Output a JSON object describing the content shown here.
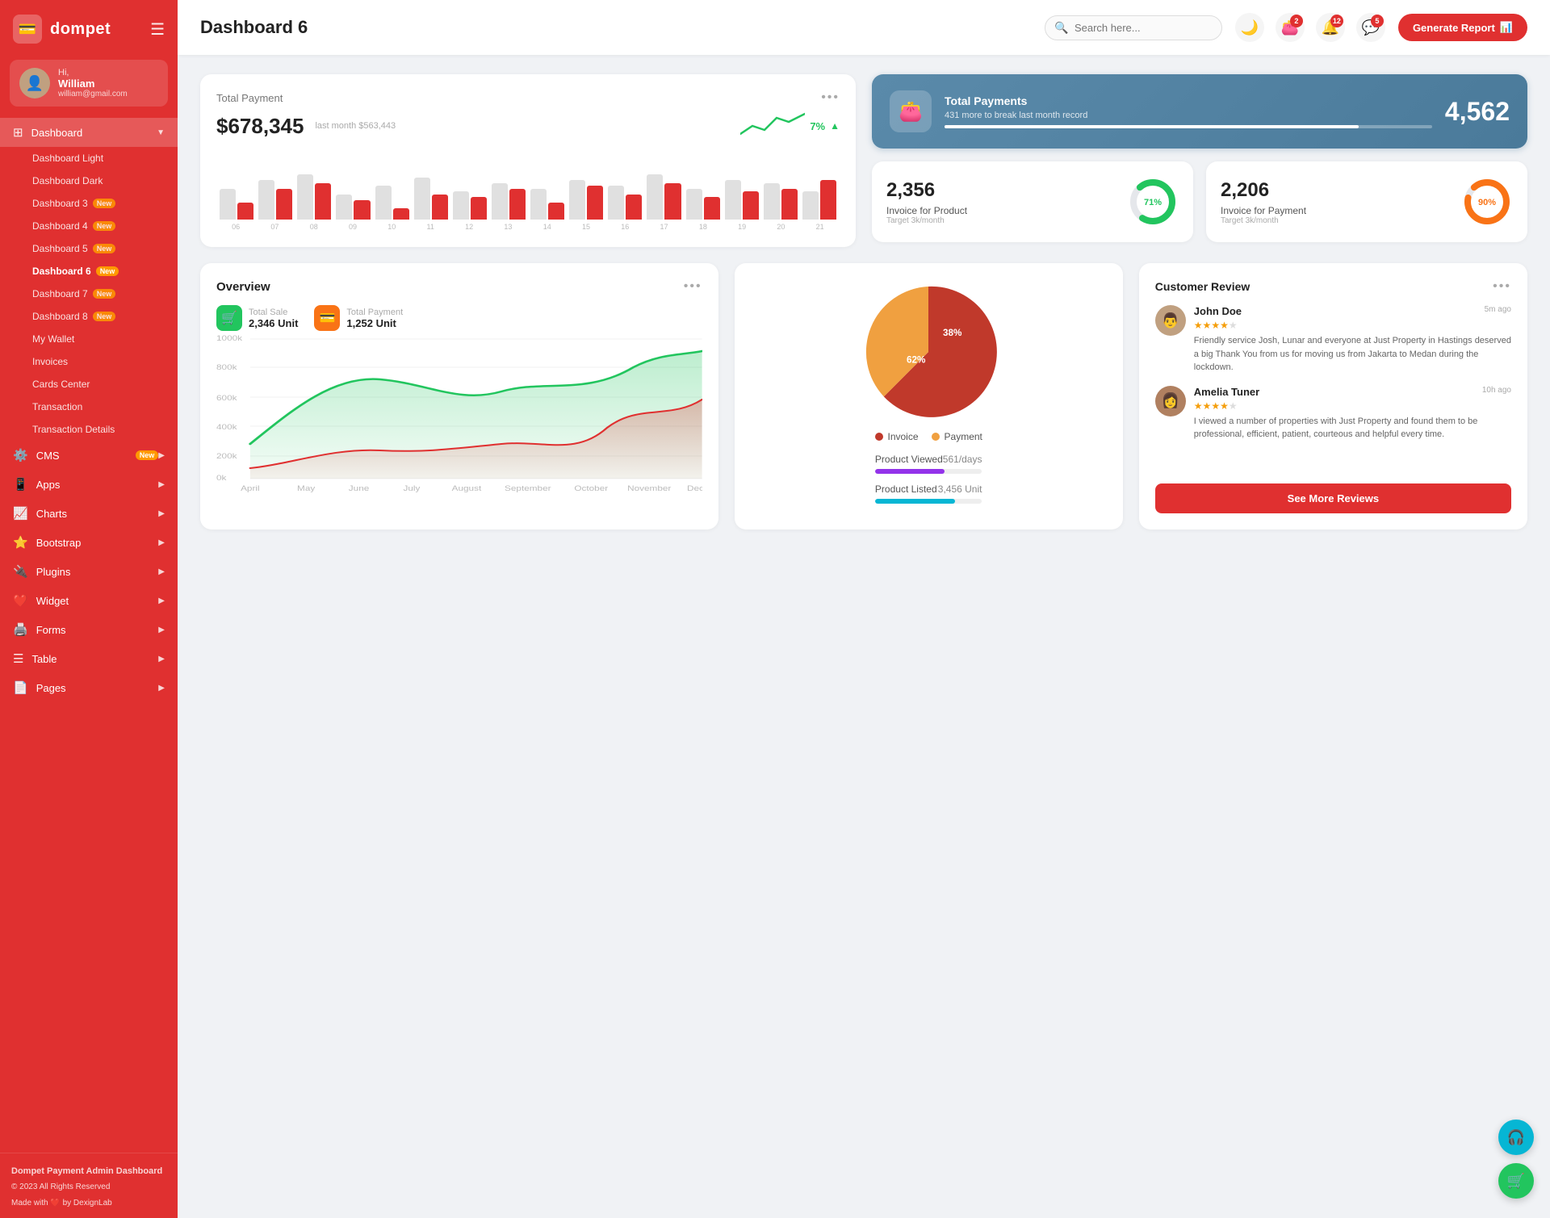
{
  "app": {
    "name": "dompet",
    "logo_icon": "💳"
  },
  "user": {
    "greeting": "Hi, William",
    "name": "William",
    "email": "william@gmail.com",
    "avatar_emoji": "👤"
  },
  "topbar": {
    "title": "Dashboard 6",
    "search_placeholder": "Search here...",
    "generate_label": "Generate Report",
    "badges": {
      "wallet": "2",
      "bell": "12",
      "chat": "5"
    }
  },
  "sidebar": {
    "dashboard_label": "Dashboard",
    "sub_items": [
      {
        "label": "Dashboard Light",
        "badge": ""
      },
      {
        "label": "Dashboard Dark",
        "badge": ""
      },
      {
        "label": "Dashboard 3",
        "badge": "New"
      },
      {
        "label": "Dashboard 4",
        "badge": "New"
      },
      {
        "label": "Dashboard 5",
        "badge": "New"
      },
      {
        "label": "Dashboard 6",
        "badge": "New",
        "active": true
      },
      {
        "label": "Dashboard 7",
        "badge": "New"
      },
      {
        "label": "Dashboard 8",
        "badge": "New"
      },
      {
        "label": "My Wallet",
        "badge": ""
      },
      {
        "label": "Invoices",
        "badge": ""
      },
      {
        "label": "Cards Center",
        "badge": ""
      },
      {
        "label": "Transaction",
        "badge": ""
      },
      {
        "label": "Transaction Details",
        "badge": ""
      }
    ],
    "nav_items": [
      {
        "label": "CMS",
        "badge": "New",
        "icon": "⚙️"
      },
      {
        "label": "Apps",
        "badge": "",
        "icon": "📱"
      },
      {
        "label": "Charts",
        "badge": "",
        "icon": "📈"
      },
      {
        "label": "Bootstrap",
        "badge": "",
        "icon": "⭐"
      },
      {
        "label": "Plugins",
        "badge": "",
        "icon": "🔌"
      },
      {
        "label": "Widget",
        "badge": "",
        "icon": "❤️"
      },
      {
        "label": "Forms",
        "badge": "",
        "icon": "🖨️"
      },
      {
        "label": "Table",
        "badge": "",
        "icon": "☰"
      },
      {
        "label": "Pages",
        "badge": "",
        "icon": "📄"
      }
    ],
    "footer_title": "Dompet Payment Admin Dashboard",
    "footer_copy": "© 2023 All Rights Reserved",
    "footer_made": "Made with ❤️ by DexignLab"
  },
  "total_payment": {
    "title": "Total Payment",
    "amount": "$678,345",
    "last_month_label": "last month $563,443",
    "trend_pct": "7%",
    "bars": [
      {
        "g": 55,
        "r": 30,
        "label": "06"
      },
      {
        "g": 70,
        "r": 55,
        "label": "07"
      },
      {
        "g": 80,
        "r": 65,
        "label": "08"
      },
      {
        "g": 45,
        "r": 35,
        "label": "09"
      },
      {
        "g": 60,
        "r": 20,
        "label": "10"
      },
      {
        "g": 75,
        "r": 45,
        "label": "11"
      },
      {
        "g": 50,
        "r": 40,
        "label": "12"
      },
      {
        "g": 65,
        "r": 55,
        "label": "13"
      },
      {
        "g": 55,
        "r": 30,
        "label": "14"
      },
      {
        "g": 70,
        "r": 60,
        "label": "15"
      },
      {
        "g": 60,
        "r": 45,
        "label": "16"
      },
      {
        "g": 80,
        "r": 65,
        "label": "17"
      },
      {
        "g": 55,
        "r": 40,
        "label": "18"
      },
      {
        "g": 70,
        "r": 50,
        "label": "19"
      },
      {
        "g": 65,
        "r": 55,
        "label": "20"
      },
      {
        "g": 50,
        "r": 70,
        "label": "21"
      }
    ]
  },
  "total_payments_card": {
    "label": "Total Payments",
    "sub": "431 more to break last month record",
    "value": "4,562",
    "progress_pct": 85
  },
  "invoice_product": {
    "number": "2,356",
    "label": "Invoice for Product",
    "target": "Target 3k/month",
    "pct": 71,
    "color": "#22c55e"
  },
  "invoice_payment": {
    "number": "2,206",
    "label": "Invoice for Payment",
    "target": "Target 3k/month",
    "pct": 90,
    "color": "#f97316"
  },
  "overview": {
    "title": "Overview",
    "total_sale_label": "Total Sale",
    "total_sale_val": "2,346 Unit",
    "total_payment_label": "Total Payment",
    "total_payment_val": "1,252 Unit",
    "months": [
      "April",
      "May",
      "June",
      "July",
      "August",
      "September",
      "October",
      "November",
      "Dec."
    ],
    "y_labels": [
      "1000k",
      "800k",
      "600k",
      "400k",
      "200k",
      "0k"
    ]
  },
  "pie_data": {
    "invoice_pct": 62,
    "payment_pct": 38,
    "invoice_label": "Invoice",
    "payment_label": "Payment"
  },
  "product_stats": {
    "viewed_label": "Product Viewed",
    "viewed_val": "561/days",
    "viewed_pct": 65,
    "listed_label": "Product Listed",
    "listed_val": "3,456 Unit",
    "listed_pct": 75
  },
  "customer_review": {
    "title": "Customer Review",
    "see_more": "See More Reviews",
    "reviews": [
      {
        "name": "John Doe",
        "time": "5m ago",
        "stars": 4,
        "total_stars": 5,
        "text": "Friendly service Josh, Lunar and everyone at Just Property in Hastings deserved a big Thank You from us for moving us from Jakarta to Medan during the lockdown.",
        "avatar_emoji": "👨"
      },
      {
        "name": "Amelia Tuner",
        "time": "10h ago",
        "stars": 4,
        "total_stars": 5,
        "text": "I viewed a number of properties with Just Property and found them to be professional, efficient, patient, courteous and helpful every time.",
        "avatar_emoji": "👩"
      }
    ]
  }
}
